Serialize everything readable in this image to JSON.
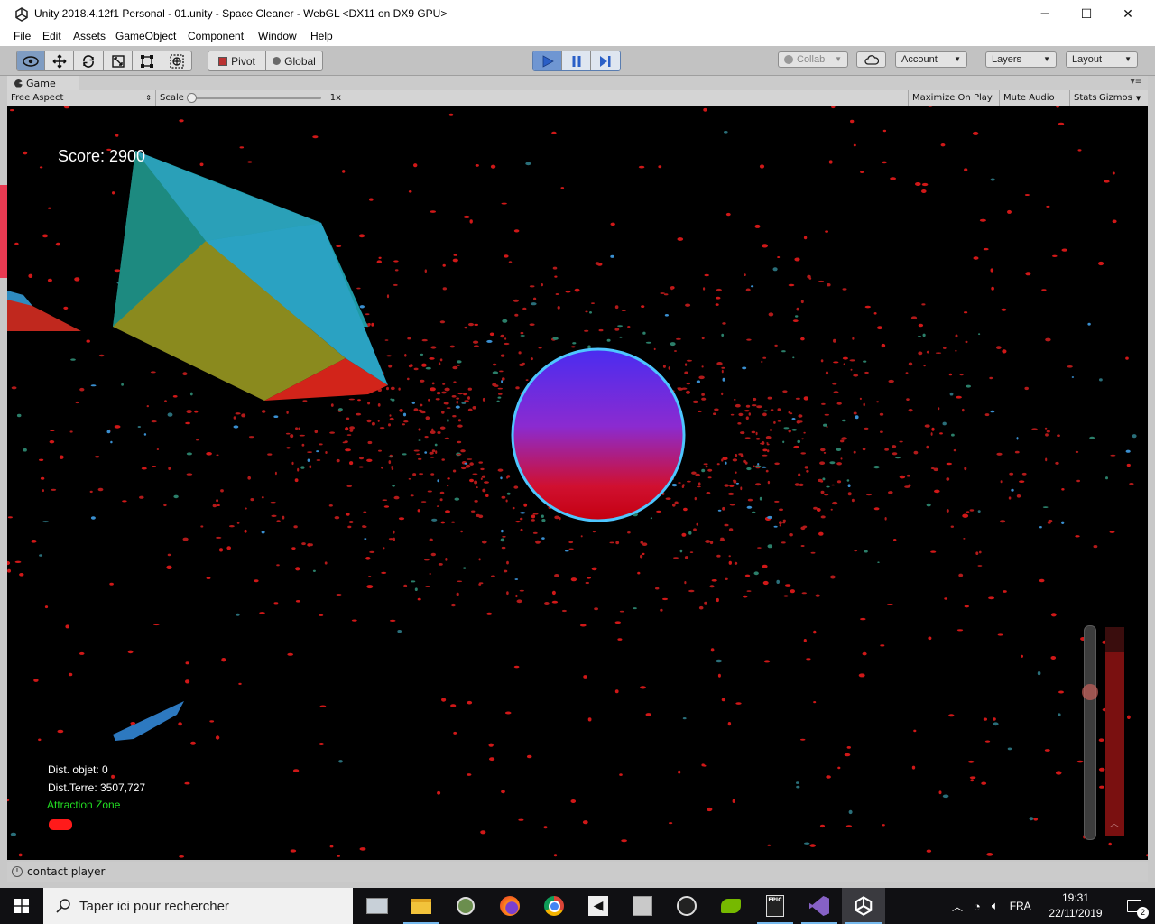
{
  "window": {
    "title": "Unity 2018.4.12f1 Personal - 01.unity - Space Cleaner - WebGL <DX11 on DX9 GPU>",
    "minimize": "─",
    "maximize": "☐",
    "close": "✕"
  },
  "menu": [
    "File",
    "Edit",
    "Assets",
    "GameObject",
    "Component",
    "Window",
    "Help"
  ],
  "toolbar": {
    "pivot_label": "Pivot",
    "global_label": "Global",
    "collab_label": "Collab",
    "account_label": "Account",
    "layers_label": "Layers",
    "layout_label": "Layout"
  },
  "game_panel": {
    "tab_label": "Game",
    "aspect_label": "Free Aspect",
    "scale_label": "Scale",
    "scale_value": "1x",
    "maximize_label": "Maximize On Play",
    "mute_label": "Mute Audio",
    "stats_label": "Stats",
    "gizmos_label": "Gizmos"
  },
  "hud": {
    "score": "Score: 2900",
    "dist_objet": "Dist. objet: 0",
    "dist_terre": "Dist.Terre: 3507,727",
    "attraction_zone": "Attraction Zone",
    "colors": {
      "score": "#ffffff",
      "attraction": "#22dd22",
      "indicator": "#ff1a1a"
    }
  },
  "status": {
    "message": "contact player"
  },
  "taskbar": {
    "search_placeholder": "Taper ici pour rechercher",
    "lang": "FRA",
    "time": "19:31",
    "date": "22/11/2019",
    "notifications": "2",
    "apps": [
      "windows-explorer-icon",
      "file-explorer-icon",
      "tool-icon",
      "firefox-icon",
      "chrome-icon",
      "unity-hub-icon",
      "blank-app-icon",
      "obs-icon",
      "nvidia-icon",
      "epic-games-icon",
      "visual-studio-icon",
      "unity-icon"
    ]
  }
}
